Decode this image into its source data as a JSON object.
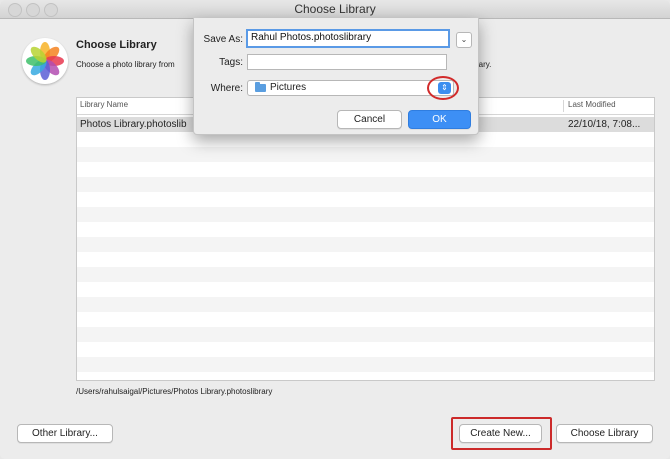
{
  "window": {
    "title": "Choose Library"
  },
  "header": {
    "heading": "Choose Library",
    "subtext": "Choose a photo library from",
    "subtext_tail": "rary."
  },
  "table": {
    "columns": [
      "Library Name",
      "Last Modified"
    ],
    "rows": [
      {
        "name": "Photos Library.photoslib",
        "modified": "22/10/18, 7:08..."
      }
    ]
  },
  "selected_path": "/Users/rahulsaigal/Pictures/Photos Library.photoslibrary",
  "buttons": {
    "other_library": "Other Library...",
    "create_new": "Create New...",
    "choose_library": "Choose Library"
  },
  "save_sheet": {
    "save_as_label": "Save As:",
    "save_as_value": "Rahul Photos.photoslibrary",
    "tags_label": "Tags:",
    "tags_value": "",
    "where_label": "Where:",
    "where_value": "Pictures",
    "cancel": "Cancel",
    "ok": "OK",
    "expand_glyph": "⌄",
    "stepper_glyph": "⇕"
  },
  "colors": {
    "accent": "#3d8ff5",
    "annotation": "#cc2a2a"
  }
}
